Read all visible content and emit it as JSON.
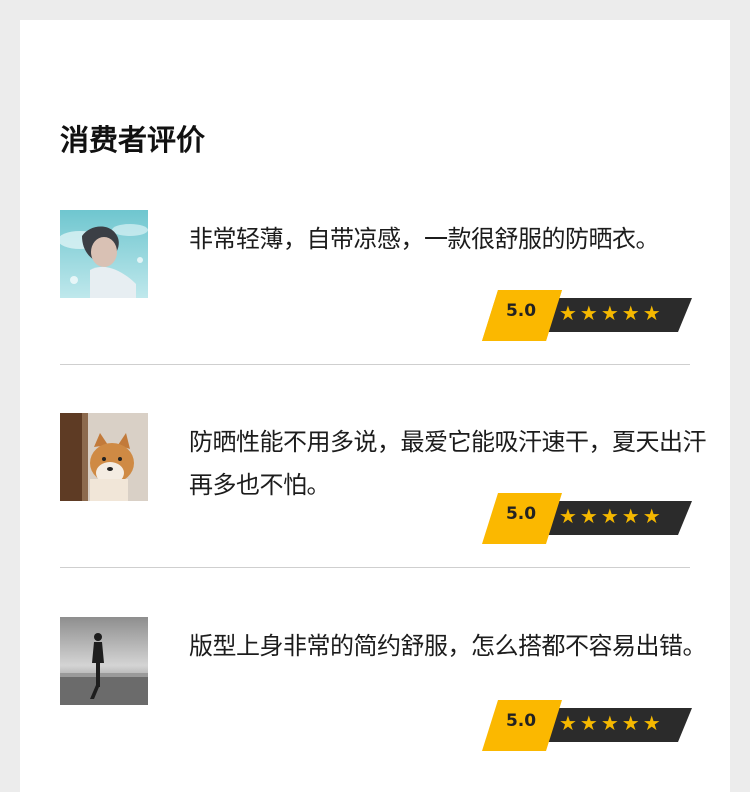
{
  "section": {
    "title": "消费者评价"
  },
  "reviews": [
    {
      "text": "非常轻薄，自带凉感，一款很舒服的防晒衣。",
      "score": "5.0",
      "stars": "★★★★★",
      "rating_value": 5,
      "avatar": "swimmer-underwater-avatar"
    },
    {
      "text": "防晒性能不用多说，最爱它能吸汗速干，夏天出汗再多也不怕。",
      "score": "5.0",
      "stars": "★★★★★",
      "rating_value": 5,
      "avatar": "shiba-dog-avatar"
    },
    {
      "text": "版型上身非常的简约舒服，怎么搭都不容易出错。",
      "score": "5.0",
      "stars": "★★★★★",
      "rating_value": 5,
      "avatar": "beach-silhouette-avatar"
    }
  ],
  "colors": {
    "badge_yellow": "#fbb800",
    "badge_dark": "#2b2b2b",
    "star": "#f5b800",
    "divider": "#cfcfcf"
  }
}
